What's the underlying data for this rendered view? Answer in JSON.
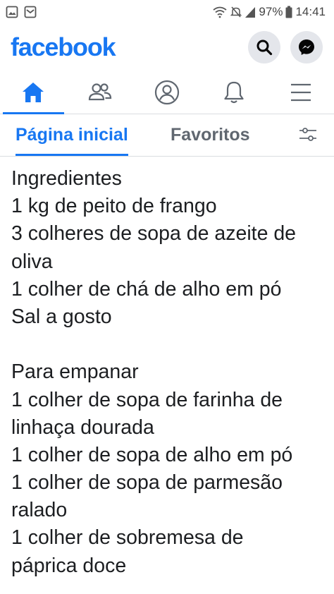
{
  "status_bar": {
    "battery_percent": "97%",
    "time": "14:41",
    "icons": [
      "image-notification-icon",
      "mail-notification-icon",
      "wifi-icon",
      "mute-icon",
      "signal-icon",
      "battery-icon"
    ]
  },
  "header": {
    "brand": "facebook",
    "brand_color": "#1877f2",
    "actions": [
      "search-icon",
      "messenger-icon"
    ]
  },
  "nav": {
    "items": [
      {
        "icon": "home-icon",
        "active": true
      },
      {
        "icon": "friends-icon",
        "active": false
      },
      {
        "icon": "profile-icon",
        "active": false
      },
      {
        "icon": "notifications-bell-icon",
        "active": false
      },
      {
        "icon": "menu-icon",
        "active": false
      }
    ]
  },
  "feed_tabs": {
    "home": "Página inicial",
    "favorites": "Favoritos",
    "filter_icon": "filter-sliders-icon"
  },
  "post": {
    "lines": [
      "Ingredientes",
      "1 kg de peito de frango",
      "3 colheres de sopa de azeite de",
      "oliva",
      "1 colher de chá de alho em pó",
      "Sal a gosto",
      "",
      "Para empanar",
      "1 colher de sopa de farinha de",
      "linhaça dourada",
      "1 colher de sopa de alho em pó",
      "1 colher de sopa de parmesão",
      "ralado",
      "1 colher de sobremesa de",
      "páprica doce"
    ]
  }
}
